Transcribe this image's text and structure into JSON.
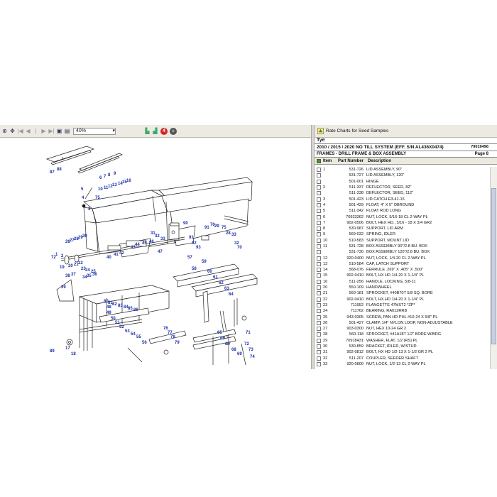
{
  "toolbar": {
    "zoom": "40%",
    "notification_count": "4"
  },
  "right_toolbar": {
    "rate_button": "Rate Charts for Seed Samples"
  },
  "catalog": {
    "brand": "Tye",
    "title": "2010 / 2015 / 2020 NO TILL SYSTEM (EFF. S/N AL436X0474)",
    "part_no": "79019496",
    "section": "FRAMES - DRILL FRAME & BOX ASSEMBLY",
    "page": "Page 8"
  },
  "columns": {
    "item": "Item",
    "part": "Part Number",
    "desc": "Description"
  },
  "parts": [
    {
      "item": "1",
      "part": "531-726",
      "desc": "LID ASSEMBLY, 90\""
    },
    {
      "item": "",
      "part": "531-727",
      "desc": "LID ASSEMBLY, 120\""
    },
    {
      "item": "",
      "part": "501-001",
      "desc": "HINGE"
    },
    {
      "item": "2",
      "part": "511-337",
      "desc": "DEFLECTOR, SEED, 82\""
    },
    {
      "item": "",
      "part": "511-338",
      "desc": "DEFLECTOR, SEED, 112\""
    },
    {
      "item": "3",
      "part": "501-423",
      "desc": "LID CATCH E3-41-15"
    },
    {
      "item": "4",
      "part": "501-429",
      "desc": "FLOAT, 4\" X 5\" OBROUND"
    },
    {
      "item": "5",
      "part": "511-342",
      "desc": "FLOAT ROD LONG"
    },
    {
      "item": "6",
      "part": "70923362",
      "desc": "NUT, LOCK, 5/16-18 CL 2-WAY PL"
    },
    {
      "item": "7",
      "part": "902-0506",
      "desc": "BOLT, HEX HD., 5/16 - 18 X 3/4 GR2"
    },
    {
      "item": "8",
      "part": "530-987",
      "desc": "SUPPORT, LID ARM"
    },
    {
      "item": "9",
      "part": "569-032",
      "desc": "SPRING, IDLER"
    },
    {
      "item": "10",
      "part": "510-583",
      "desc": "SUPPORT, MOUNT LID"
    },
    {
      "item": "11",
      "part": "531-728",
      "desc": "BOX ASSEMBLY 90\"/2.8 BU. BOX"
    },
    {
      "item": "",
      "part": "531-730",
      "desc": "BOX ASSEMBLY 120\"/2.8 BU. BOX"
    },
    {
      "item": "12",
      "part": "920-0400",
      "desc": "NUT, LOCK, 1/4-20 CL 2-WAY PL"
    },
    {
      "item": "13",
      "part": "510-584",
      "desc": "CAP, LATCH SUPPORT"
    },
    {
      "item": "14",
      "part": "568-076",
      "desc": "FERRULE .269\" X .405\" X .500\""
    },
    {
      "item": "15",
      "part": "902-0410",
      "desc": "BOLT, HX HD 1/4-20 X 1-1/4\" PL"
    },
    {
      "item": "16",
      "part": "511-256",
      "desc": "HANDLE, LOCKING, 5/8-11"
    },
    {
      "item": "20",
      "part": "550-109",
      "desc": "HANDWHEEL"
    },
    {
      "item": "21",
      "part": "560-181",
      "desc": "SPROCKET, #40B70T 5/8 SQ. BORE"
    },
    {
      "item": "22",
      "part": "902-0410",
      "desc": "BOLT, HX HD 1/4-20 X 1-1/4\" PL"
    },
    {
      "item": "23",
      "part": "711952",
      "desc": "FLANGETTE 47MST2 *ZP*"
    },
    {
      "item": "24",
      "part": "711762",
      "desc": "BEARING, RA012RRB"
    },
    {
      "item": "25",
      "part": "943-0305",
      "desc": "SCREW, PAN HD PHL #10-24 X 5/8\" PL"
    },
    {
      "item": "26",
      "part": "501-427",
      "desc": "CLAMP, 1/4\" NYLON LOOP, NON-ADJUSTABLE"
    },
    {
      "item": "27",
      "part": "903-0300",
      "desc": "NUT, HEX 10-24 GR 2"
    },
    {
      "item": "28",
      "part": "560-118",
      "desc": "SPROCKET, #41A18T 1/2\" BORE W/BRG"
    },
    {
      "item": "29",
      "part": "70918431",
      "desc": "WASHER, FLAT, 1/2 (RS) PL"
    },
    {
      "item": "30",
      "part": "530-859",
      "desc": "BRACKET, IDLER, W/STUD"
    },
    {
      "item": "31",
      "part": "902-0812",
      "desc": "BOLT, HX HD 1/2-13 X 1-1/2 GR 2 PL"
    },
    {
      "item": "32",
      "part": "511-207",
      "desc": "COUPLER, SEEDER SHAFT"
    },
    {
      "item": "33",
      "part": "920-0800",
      "desc": "NUT, LOCK, 1/2-13 CL 2-WAY PL"
    }
  ],
  "callouts": [
    {
      "t": "87"
    },
    {
      "t": "88"
    },
    {
      "t": "6"
    },
    {
      "t": "7"
    },
    {
      "t": "8"
    },
    {
      "t": "9"
    },
    {
      "t": "5"
    },
    {
      "t": "4"
    },
    {
      "t": "3"
    },
    {
      "t": "75"
    },
    {
      "t": "10"
    },
    {
      "t": "11"
    },
    {
      "t": "12"
    },
    {
      "t": "13"
    },
    {
      "t": "14"
    },
    {
      "t": "15"
    },
    {
      "t": "16"
    },
    {
      "t": "26"
    },
    {
      "t": "27"
    },
    {
      "t": "28"
    },
    {
      "t": "29"
    },
    {
      "t": "30"
    },
    {
      "t": "1"
    },
    {
      "t": "2"
    },
    {
      "t": "72"
    },
    {
      "t": "19"
    },
    {
      "t": "20"
    },
    {
      "t": "21"
    },
    {
      "t": "22"
    },
    {
      "t": "23"
    },
    {
      "t": "24"
    },
    {
      "t": "25"
    },
    {
      "t": "39"
    },
    {
      "t": "38"
    },
    {
      "t": "37"
    },
    {
      "t": "34"
    },
    {
      "t": "35"
    },
    {
      "t": "36"
    },
    {
      "t": "43"
    },
    {
      "t": "44"
    },
    {
      "t": "45"
    },
    {
      "t": "46"
    },
    {
      "t": "47"
    },
    {
      "t": "42"
    },
    {
      "t": "41"
    },
    {
      "t": "40"
    },
    {
      "t": "90"
    },
    {
      "t": "91"
    },
    {
      "t": "92"
    },
    {
      "t": "93"
    },
    {
      "t": "31"
    },
    {
      "t": "32"
    },
    {
      "t": "33"
    },
    {
      "t": "91"
    },
    {
      "t": "70"
    },
    {
      "t": "29"
    },
    {
      "t": "75"
    },
    {
      "t": "28"
    },
    {
      "t": "33"
    },
    {
      "t": "32"
    },
    {
      "t": "70"
    },
    {
      "t": "57"
    },
    {
      "t": "58"
    },
    {
      "t": "59"
    },
    {
      "t": "60"
    },
    {
      "t": "61"
    },
    {
      "t": "62"
    },
    {
      "t": "63"
    },
    {
      "t": "64"
    },
    {
      "t": "80"
    },
    {
      "t": "81"
    },
    {
      "t": "82"
    },
    {
      "t": "83"
    },
    {
      "t": "84"
    },
    {
      "t": "85"
    },
    {
      "t": "86"
    },
    {
      "t": "48"
    },
    {
      "t": "49"
    },
    {
      "t": "50"
    },
    {
      "t": "51"
    },
    {
      "t": "52"
    },
    {
      "t": "53"
    },
    {
      "t": "54"
    },
    {
      "t": "55"
    },
    {
      "t": "56"
    },
    {
      "t": "76"
    },
    {
      "t": "77"
    },
    {
      "t": "78"
    },
    {
      "t": "79"
    },
    {
      "t": "65"
    },
    {
      "t": "66"
    },
    {
      "t": "67"
    },
    {
      "t": "68"
    },
    {
      "t": "69"
    },
    {
      "t": "71"
    },
    {
      "t": "72"
    },
    {
      "t": "73"
    },
    {
      "t": "74"
    },
    {
      "t": "17"
    },
    {
      "t": "18"
    },
    {
      "t": "89"
    }
  ]
}
